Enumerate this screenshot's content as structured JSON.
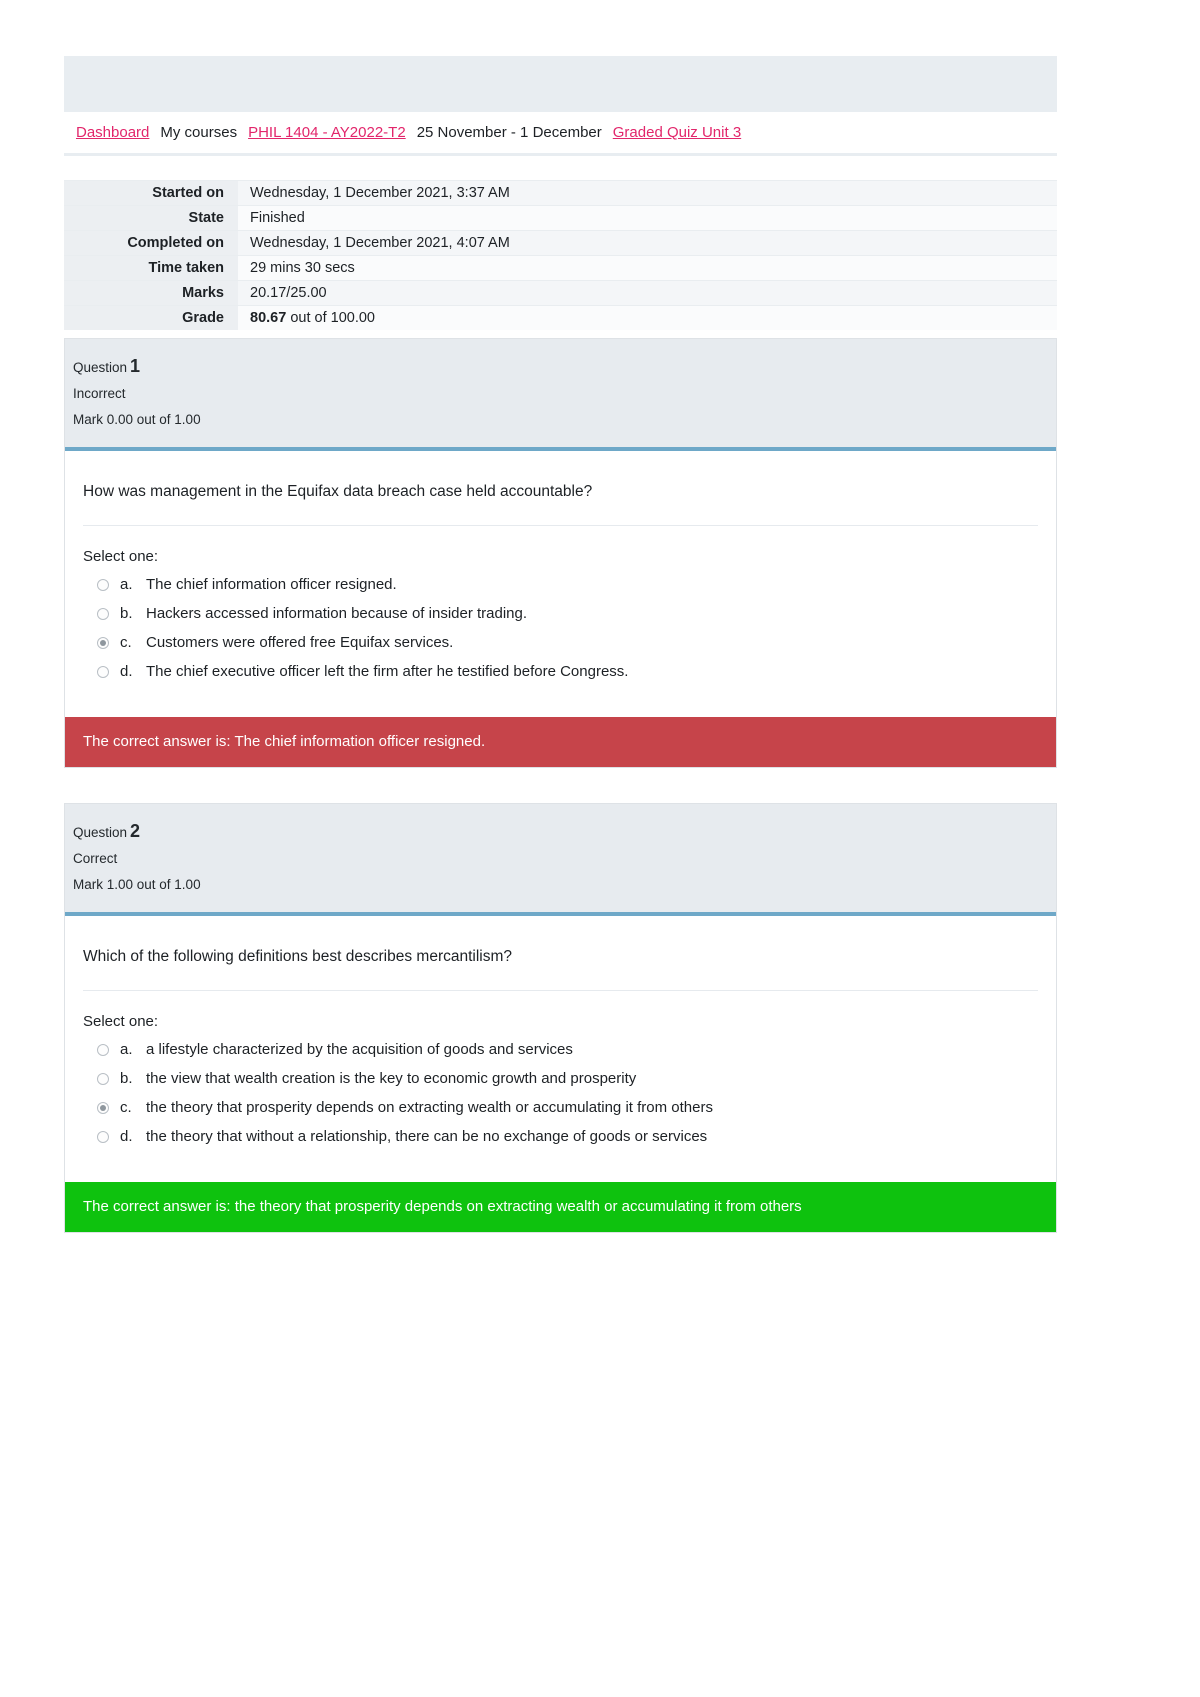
{
  "breadcrumb": {
    "items": [
      {
        "label": "Dashboard",
        "link": true
      },
      {
        "label": "My courses",
        "link": false
      },
      {
        "label": "PHIL 1404 - AY2022-T2",
        "link": true
      },
      {
        "label": "25 November - 1 December",
        "link": false
      },
      {
        "label": "Graded Quiz Unit 3",
        "link": true
      }
    ]
  },
  "summary": {
    "rows": [
      {
        "key": "Started on",
        "value": "Wednesday, 1 December 2021, 3:37 AM"
      },
      {
        "key": "State",
        "value": "Finished"
      },
      {
        "key": "Completed on",
        "value": "Wednesday, 1 December 2021, 4:07 AM"
      },
      {
        "key": "Time taken",
        "value": "29 mins 30 secs"
      },
      {
        "key": "Marks",
        "value": "20.17/25.00"
      }
    ],
    "grade": {
      "key": "Grade",
      "value_strong": "80.67",
      "value_rest": " out of 100.00"
    }
  },
  "questions": [
    {
      "label": "Question",
      "number": "1",
      "state": "Incorrect",
      "mark": "Mark 0.00 out of 1.00",
      "text": "How was management in the Equifax data breach case held accountable?",
      "select_label": "Select one:",
      "options": [
        {
          "letter": "a.",
          "text": "The chief information officer resigned.",
          "selected": false
        },
        {
          "letter": "b.",
          "text": "Hackers accessed information because of insider trading.",
          "selected": false
        },
        {
          "letter": "c.",
          "text": "Customers were offered free Equifax services.",
          "selected": true
        },
        {
          "letter": "d.",
          "text": "The chief executive officer left the firm after he testified before Congress.",
          "selected": false
        }
      ],
      "feedback": "The correct answer is: The chief information officer resigned.",
      "feedback_type": "incorrect"
    },
    {
      "label": "Question",
      "number": "2",
      "state": "Correct",
      "mark": "Mark 1.00 out of 1.00",
      "text": "Which of the following definitions best describes mercantilism?",
      "select_label": "Select one:",
      "options": [
        {
          "letter": "a.",
          "text": "a lifestyle characterized by the acquisition of goods and services",
          "selected": false
        },
        {
          "letter": "b.",
          "text": "the view that wealth creation is the key to economic growth and prosperity",
          "selected": false
        },
        {
          "letter": "c.",
          "text": "the theory that prosperity depends on extracting wealth or accumulating it from others",
          "selected": true
        },
        {
          "letter": "d.",
          "text": "the theory that without a relationship, there can be no exchange of goods or services",
          "selected": false
        }
      ],
      "feedback": "The correct answer is: the theory that prosperity depends on extracting wealth or accumulating it from others",
      "feedback_type": "correct"
    }
  ],
  "colors": {
    "link": "#e2266b",
    "incorrect_bar": "#c6444a",
    "correct_bar": "#0ec20e",
    "question_accent": "#6ea8c8",
    "header_bg": "#e7ebef"
  }
}
